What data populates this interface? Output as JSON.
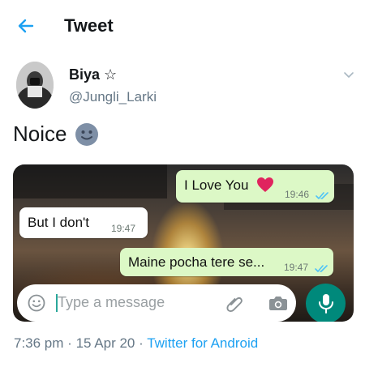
{
  "header": {
    "title": "Tweet",
    "back_icon": "arrow-left-icon",
    "accent": "#1da1f2"
  },
  "author": {
    "display_name": "Biya",
    "name_symbol": "☆",
    "handle": "@Jungli_Larki",
    "caret_icon": "chevron-down-icon"
  },
  "tweet": {
    "text": "Noice",
    "emoji": "🙂"
  },
  "chat": {
    "messages": [
      {
        "text": "I Love You",
        "emoji": "❤️",
        "time": "19:46",
        "direction": "out",
        "ticks": "double-check-blue"
      },
      {
        "text": "But I don't",
        "time": "19:47",
        "direction": "in"
      },
      {
        "text": "Maine pocha tere se...",
        "time": "19:47",
        "direction": "out",
        "ticks": "double-check-blue"
      }
    ],
    "input": {
      "placeholder": "Type a message",
      "icons": [
        "emoji-icon",
        "paperclip-icon",
        "camera-icon",
        "mic-icon"
      ]
    },
    "colors": {
      "outgoing": "#dcf8c6",
      "incoming": "#ffffff",
      "mic": "#00897b",
      "ticks": "#4fc3f7"
    }
  },
  "meta": {
    "time": "7:36 pm",
    "separator": "·",
    "date": "15 Apr 20",
    "source": "Twitter for Android"
  }
}
